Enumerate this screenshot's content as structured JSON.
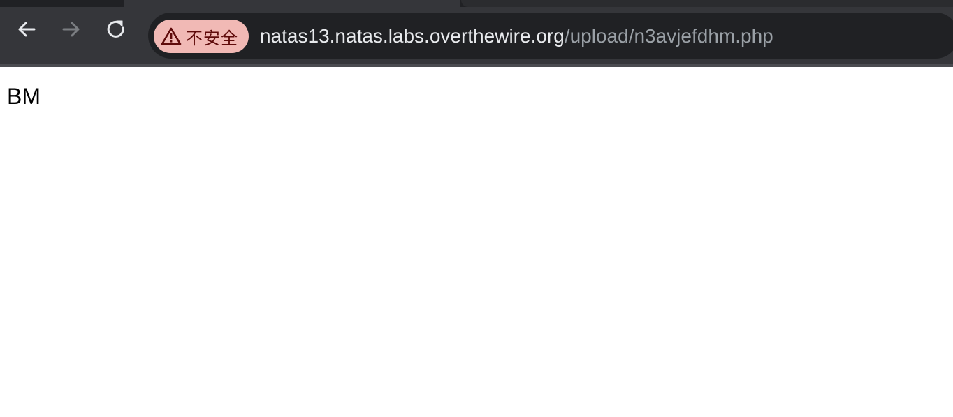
{
  "browser": {
    "security_chip": {
      "label": "不安全",
      "icon": "warning-triangle-icon",
      "background": "#f1b9b5",
      "text_color": "#5f0b0b"
    },
    "url": {
      "host": "natas13.natas.labs.overthewire.org",
      "path": "/upload/n3avjefdhm.php"
    },
    "nav": {
      "back_icon": "back-arrow-icon",
      "forward_icon": "forward-arrow-icon",
      "reload_icon": "reload-icon"
    },
    "colors": {
      "toolbar": "#35363a",
      "omnibox": "#202124"
    }
  },
  "page": {
    "body_text": "BM"
  }
}
